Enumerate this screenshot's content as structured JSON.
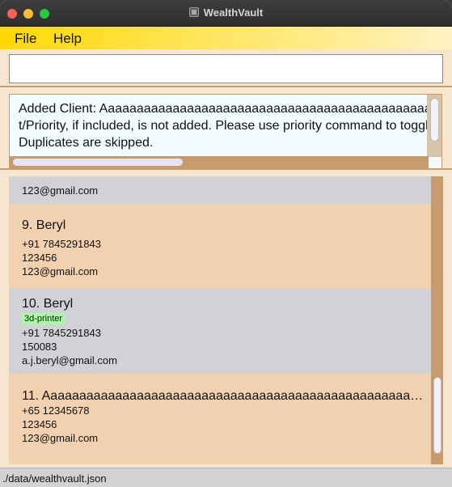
{
  "window": {
    "title": "WealthVault"
  },
  "menu": {
    "file": "File",
    "help": "Help"
  },
  "command": {
    "value": "",
    "placeholder": ""
  },
  "result": {
    "lines": [
      "Added Client: Aaaaaaaaaaaaaaaaaaaaaaaaaaaaaaaaaaaaaaaaaaaaaaaaaaaaa",
      "t/Priority, if included, is not added. Please use priority command to toggle",
      "Duplicates are skipped."
    ]
  },
  "clients": [
    {
      "name": "",
      "phone": "",
      "address": "",
      "email": "123@gmail.com",
      "tags": []
    },
    {
      "name": "9. Beryl",
      "phone": "+91 7845291843",
      "address": "123456",
      "email": "123@gmail.com",
      "tags": []
    },
    {
      "name": "10. Beryl",
      "phone": "+91 7845291843",
      "address": "150083",
      "email": "a.j.beryl@gmail.com",
      "tags": [
        "3d-printer"
      ]
    },
    {
      "name": "11. Aaaaaaaaaaaaaaaaaaaaaaaaaaaaaaaaaaaaaaaaaaaaaaaaaaaaaa...",
      "phone": "+65 12345678",
      "address": "123456",
      "email": "123@gmail.com",
      "tags": []
    }
  ],
  "status": {
    "path": "./data/wealthvault.json"
  },
  "colors": {
    "menubar_start": "#ffd900",
    "card_even": "#d1d2d6",
    "card_odd": "#f2d1b0",
    "tag_bg": "#a6ffa1",
    "accent_border": "#c79b6c"
  },
  "icons": {
    "title": "app-icon"
  }
}
